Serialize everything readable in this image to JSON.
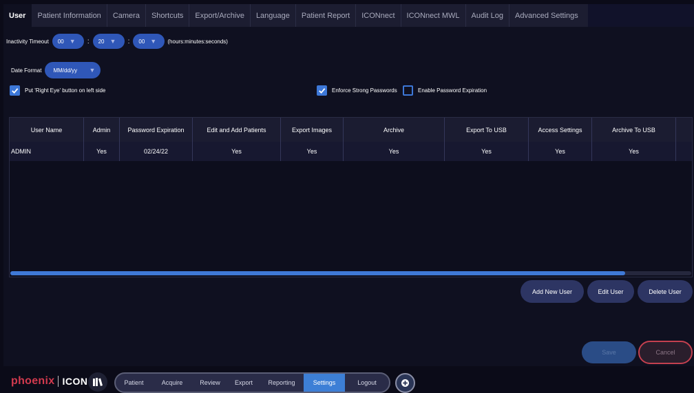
{
  "tabs": [
    {
      "label": "User",
      "active": true
    },
    {
      "label": "Patient Information"
    },
    {
      "label": "Camera"
    },
    {
      "label": "Shortcuts"
    },
    {
      "label": "Export/Archive"
    },
    {
      "label": "Language"
    },
    {
      "label": "Patient Report"
    },
    {
      "label": "ICONnect"
    },
    {
      "label": "ICONnect MWL"
    },
    {
      "label": "Audit Log"
    },
    {
      "label": "Advanced Settings"
    }
  ],
  "inactivity": {
    "label": "Inactivity Timeout",
    "hours": "00",
    "minutes": "20",
    "seconds": "00",
    "separator": ":",
    "units": "(hours:minutes:seconds)"
  },
  "date_format": {
    "label": "Date Format",
    "value": "MM/dd/yy"
  },
  "checkboxes": {
    "right_eye": {
      "label": "Put 'Right Eye' button on left side",
      "checked": true
    },
    "strong_pw": {
      "label": "Enforce Strong Passwords",
      "checked": true
    },
    "pw_expiration": {
      "label": "Enable Password Expiration",
      "checked": false
    }
  },
  "table": {
    "columns": [
      "User Name",
      "Admin",
      "Password Expiration",
      "Edit and Add Patients",
      "Export Images",
      "Archive",
      "Export To USB",
      "Access Settings",
      "Archive To USB"
    ],
    "rows": [
      [
        "ADMIN",
        "Yes",
        "02/24/22",
        "Yes",
        "Yes",
        "Yes",
        "Yes",
        "Yes",
        "Yes"
      ]
    ]
  },
  "actions": {
    "add_user": "Add New User",
    "edit_user": "Edit User",
    "delete_user": "Delete User",
    "save": "Save",
    "cancel": "Cancel"
  },
  "logo": {
    "brand": "phoenix",
    "product": "ICON"
  },
  "nav": [
    {
      "label": "Patient"
    },
    {
      "label": "Acquire"
    },
    {
      "label": "Review"
    },
    {
      "label": "Export"
    },
    {
      "label": "Reporting"
    },
    {
      "label": "Settings",
      "active": true
    },
    {
      "label": "Logout"
    }
  ],
  "colors": {
    "accent": "#3d7fd6",
    "panel": "#0f1020",
    "danger": "#c4404f",
    "brand_red": "#d23a4e"
  },
  "icons": {
    "book": "book-icon",
    "plus": "plus-circle-icon",
    "check": "check-icon",
    "dropdown": "chevron-down-icon"
  }
}
